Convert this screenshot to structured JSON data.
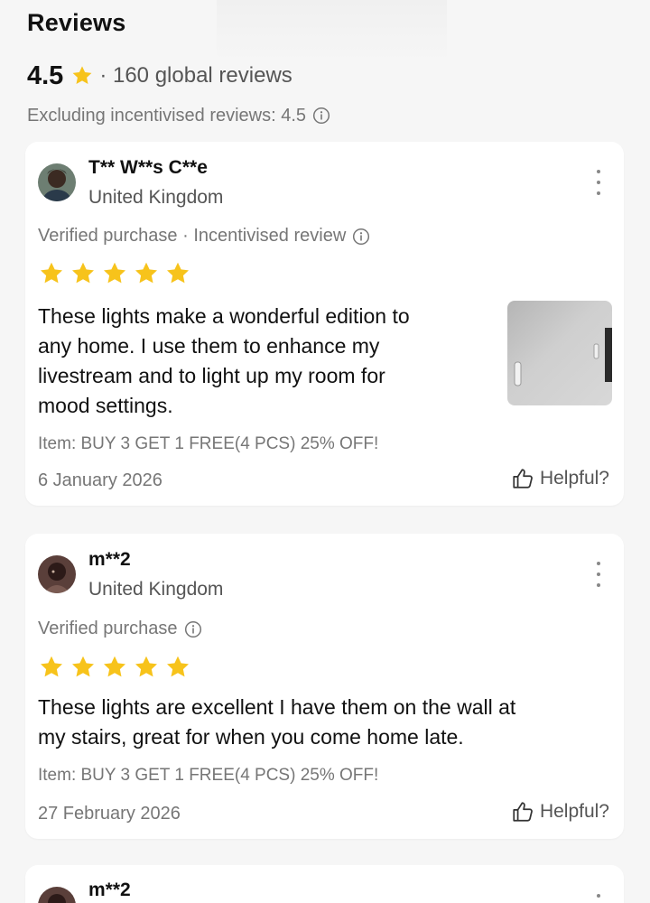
{
  "header": {
    "title": "Reviews",
    "rating": "4.5",
    "global_reviews": "· 160 global reviews",
    "excluding_text": "Excluding incentivised reviews: 4.5"
  },
  "colors": {
    "star": "#f7c31b",
    "muted_text": "#767676",
    "card_bg": "#ffffff",
    "page_bg": "#f6f6f6"
  },
  "icons": {
    "star": "star-icon",
    "info": "info-icon",
    "more": "more-vertical-icon",
    "helpful": "thumbs-up-icon"
  },
  "reviews": [
    {
      "author": "T** W**s C**e",
      "country": "United Kingdom",
      "meta": "Verified purchase · Incentivised review",
      "stars": 5,
      "text_lines": [
        "These lights make a wonderful edition to",
        "any home. I use them to enhance my",
        "livestream and to light up my room for",
        "mood settings."
      ],
      "item": "Item: BUY 3 GET 1 FREE(4 PCS) 25% OFF!",
      "date": "6 January 2026",
      "helpful_label": "Helpful?"
    },
    {
      "author": "m**2",
      "country": "United Kingdom",
      "meta": "Verified purchase",
      "stars": 5,
      "text_lines": [
        "These lights are excellent I have them on the wall at",
        "my stairs, great for when you come home late."
      ],
      "item": "Item: BUY 3 GET 1 FREE(4 PCS) 25% OFF!",
      "date": "27 February 2026",
      "helpful_label": "Helpful?"
    },
    {
      "author": "m**2"
    }
  ]
}
